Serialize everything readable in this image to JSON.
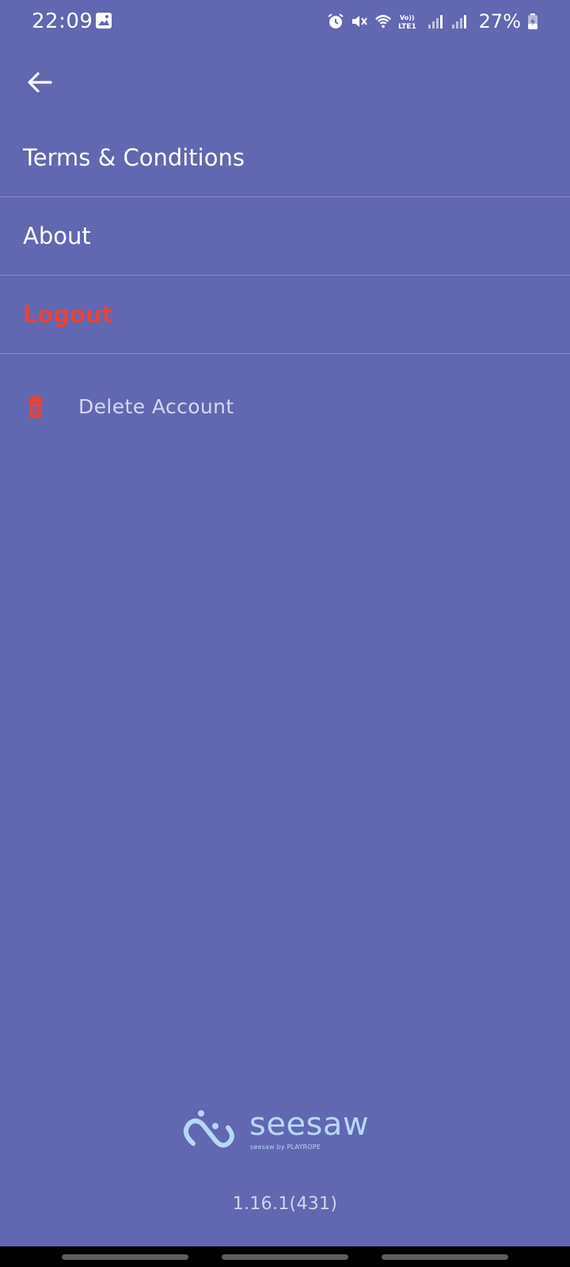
{
  "status_bar": {
    "time": "22:09",
    "battery_percent": "27%",
    "network_label": "VoLTE1",
    "icons": [
      "gallery-icon",
      "alarm-icon",
      "mute-icon",
      "wifi-icon",
      "volte-icon",
      "signal-icon",
      "signal-icon",
      "battery-charging-icon"
    ]
  },
  "header": {
    "back_icon": "arrow-left-icon"
  },
  "menu": {
    "items": [
      {
        "label": "Terms & Conditions"
      },
      {
        "label": "About"
      },
      {
        "label": "Logout",
        "color": "#e2453f"
      }
    ],
    "delete_account": {
      "label": "Delete Account",
      "icon": "trash-icon",
      "icon_color": "#e2453f"
    }
  },
  "footer": {
    "logo_text": "seesaw",
    "logo_tagline": "seesaw by PLAYROPE",
    "version": "1.16.1(431)"
  },
  "colors": {
    "background": "#6167b0",
    "danger": "#e2453f",
    "logo": "#b6d8f5"
  }
}
